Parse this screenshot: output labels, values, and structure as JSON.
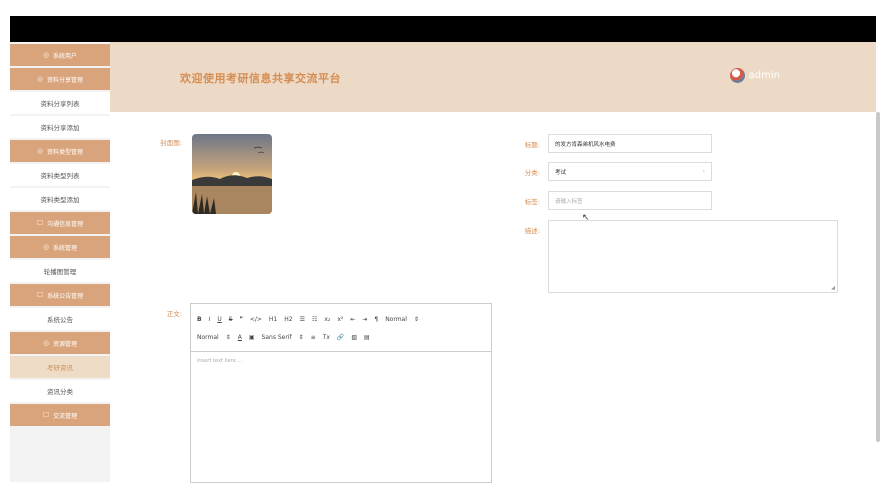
{
  "sidebar": {
    "items": [
      {
        "label": "系统用户",
        "kind": "group"
      },
      {
        "label": "资料分享管理",
        "kind": "group"
      },
      {
        "label": "资料分享列表",
        "kind": "item"
      },
      {
        "label": "资料分享添加",
        "kind": "item"
      },
      {
        "label": "资料类型管理",
        "kind": "group"
      },
      {
        "label": "资料类型列表",
        "kind": "item"
      },
      {
        "label": "资料类型添加",
        "kind": "item"
      },
      {
        "label": "沟通信息管理",
        "kind": "group"
      },
      {
        "label": "系统管理",
        "kind": "group"
      },
      {
        "label": "轮播图管理",
        "kind": "item"
      },
      {
        "label": "系统公告管理",
        "kind": "group"
      },
      {
        "label": "系统公告",
        "kind": "item"
      },
      {
        "label": "资源管理",
        "kind": "group"
      },
      {
        "label": "考研资讯",
        "kind": "item",
        "active": true
      },
      {
        "label": "资讯分类",
        "kind": "item"
      },
      {
        "label": "交流管理",
        "kind": "group"
      }
    ]
  },
  "header": {
    "welcome": "欢迎使用考研信息共享交流平台",
    "username": "admin"
  },
  "form": {
    "cover_label": "封面图:",
    "title_label": "标题:",
    "title_value": "的发方肯森弟机风水电费",
    "category_label": "分类:",
    "category_value": "考试",
    "tags_label": "标签:",
    "tags_placeholder": "请输入标签",
    "desc_label": "描述:",
    "content_label": "正文:"
  },
  "editor": {
    "toolbar_row1": [
      "B",
      "I",
      "U",
      "S",
      "❞",
      "</>",
      "H1",
      "H2",
      "☰",
      "☷",
      "x₂",
      "x²",
      "⇤",
      "⇥",
      "¶",
      "Normal",
      "⇕"
    ],
    "toolbar_row2": [
      "Normal",
      "⇕",
      "A",
      "▣",
      "Sans Serif",
      "⇕",
      "≡",
      "Tx",
      "🔗",
      "▧",
      "▤"
    ],
    "placeholder": "Insert text here ..."
  },
  "colors": {
    "accent": "#d9a47b",
    "header_bg": "#ecdac7",
    "label": "#d68d52"
  }
}
